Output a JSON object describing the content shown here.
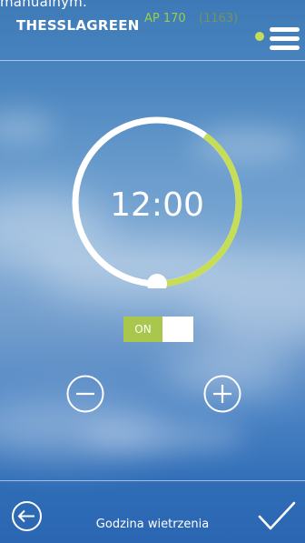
{
  "top_caption": "manualnym.",
  "header": {
    "brand": "THESSLAGREEN",
    "model": "AP 170",
    "serial": "(1163)",
    "status_color": "#c6dd58"
  },
  "timer": {
    "time": "12:00",
    "ring_progress_percent": 40,
    "ring_active_color": "#c6dd58",
    "ring_track_color": "#ffffff"
  },
  "toggle": {
    "label": "ON",
    "state": "on",
    "active_color": "#a9c64d"
  },
  "controls": {
    "decrease_icon": "minus-circle-icon",
    "increase_icon": "plus-circle-icon"
  },
  "footer": {
    "title": "Godzina wietrzenia",
    "back_icon": "arrow-left-circle-icon",
    "confirm_icon": "checkmark-icon"
  }
}
